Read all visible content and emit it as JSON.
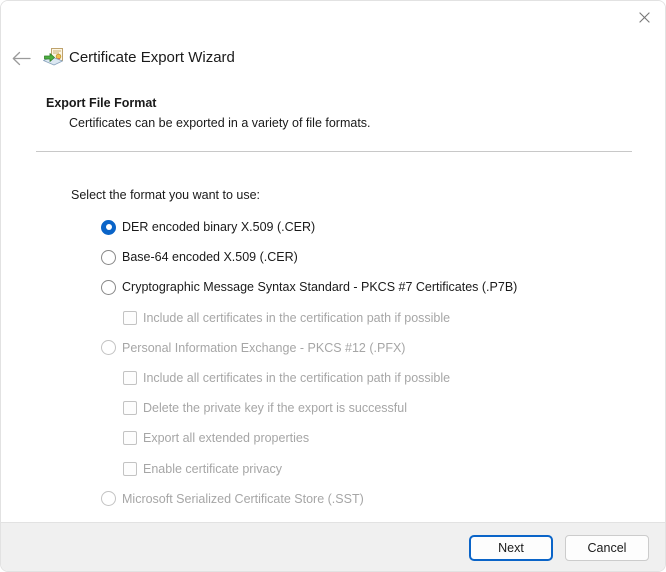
{
  "window": {
    "title": "Certificate Export Wizard",
    "close_label": "Close",
    "back_label": "Back"
  },
  "section": {
    "heading": "Export File Format",
    "subheading": "Certificates can be exported in a variety of file formats.",
    "prompt": "Select the format you want to use:"
  },
  "options": [
    {
      "type": "radio",
      "label": "DER encoded binary X.509 (.CER)",
      "selected": true,
      "disabled": false,
      "indent": false
    },
    {
      "type": "radio",
      "label": "Base-64 encoded X.509 (.CER)",
      "selected": false,
      "disabled": false,
      "indent": false
    },
    {
      "type": "radio",
      "label": "Cryptographic Message Syntax Standard - PKCS #7 Certificates (.P7B)",
      "selected": false,
      "disabled": false,
      "indent": false
    },
    {
      "type": "checkbox",
      "label": "Include all certificates in the certification path if possible",
      "checked": false,
      "disabled": true,
      "indent": true
    },
    {
      "type": "radio",
      "label": "Personal Information Exchange - PKCS #12 (.PFX)",
      "selected": false,
      "disabled": true,
      "indent": false
    },
    {
      "type": "checkbox",
      "label": "Include all certificates in the certification path if possible",
      "checked": false,
      "disabled": true,
      "indent": true
    },
    {
      "type": "checkbox",
      "label": "Delete the private key if the export is successful",
      "checked": false,
      "disabled": true,
      "indent": true
    },
    {
      "type": "checkbox",
      "label": "Export all extended properties",
      "checked": false,
      "disabled": true,
      "indent": true
    },
    {
      "type": "checkbox",
      "label": "Enable certificate privacy",
      "checked": false,
      "disabled": true,
      "indent": true
    },
    {
      "type": "radio",
      "label": "Microsoft Serialized Certificate Store (.SST)",
      "selected": false,
      "disabled": true,
      "indent": false
    }
  ],
  "footer": {
    "next_label": "Next",
    "cancel_label": "Cancel"
  },
  "colors": {
    "accent": "#0a64c8",
    "text": "#1a1a1a",
    "disabled_text": "#a6a6a6",
    "footer_bg": "#f0f0f0",
    "border": "#e2e2e2",
    "divider": "#c8c8c8"
  }
}
